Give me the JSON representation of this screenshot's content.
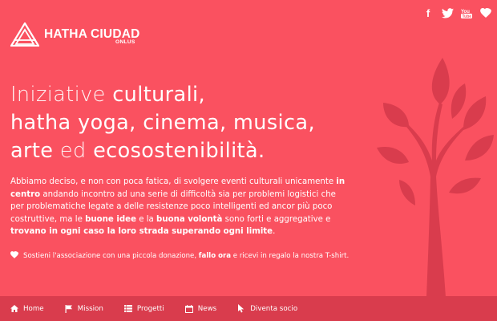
{
  "brand": {
    "name": "HATHA CIUDAD",
    "sub": "ONLUS"
  },
  "social": [
    {
      "icon": "facebook-icon",
      "glyph": "f"
    },
    {
      "icon": "twitter-icon",
      "glyph": ""
    },
    {
      "icon": "youtube-icon",
      "glyph": ""
    },
    {
      "icon": "heart-icon",
      "glyph": ""
    }
  ],
  "headline": {
    "l1a": "Iniziative ",
    "l1b": "culturali,",
    "l2": "hatha yoga, cinema, musica,",
    "l3a": "arte",
    "l3b": " ed ",
    "l3c": "ecosostenibilità."
  },
  "body": {
    "t1": "Abbiamo deciso, e non con poca fatica, di svolgere eventi culturali unicamente ",
    "b1": "in centro",
    "t2": " andando incontro ad una serie di difficoltà sia per problemi logistici che per problematiche legate a delle resistenze poco intelligenti ed ancor più poco costruttive, ma le ",
    "b2": "buone idee",
    "t3": " e la ",
    "b3": "buona volontà",
    "t4": " sono forti e aggregative e ",
    "b4": "trovano in ogni caso la loro strada superando ogni limite",
    "t5": "."
  },
  "support": {
    "t1": "Sostieni l'associazione con una piccola donazione, ",
    "b1": "fallo ora",
    "t2": " e ricevi in regalo la nostra T-shirt."
  },
  "nav": {
    "home": "Home",
    "mission": "Mission",
    "progetti": "Progetti",
    "news": "News",
    "socio": "Diventa socio"
  },
  "colors": {
    "background": "#fa5160",
    "navbar": "#d93c4d",
    "tree": "#d93c4d"
  }
}
